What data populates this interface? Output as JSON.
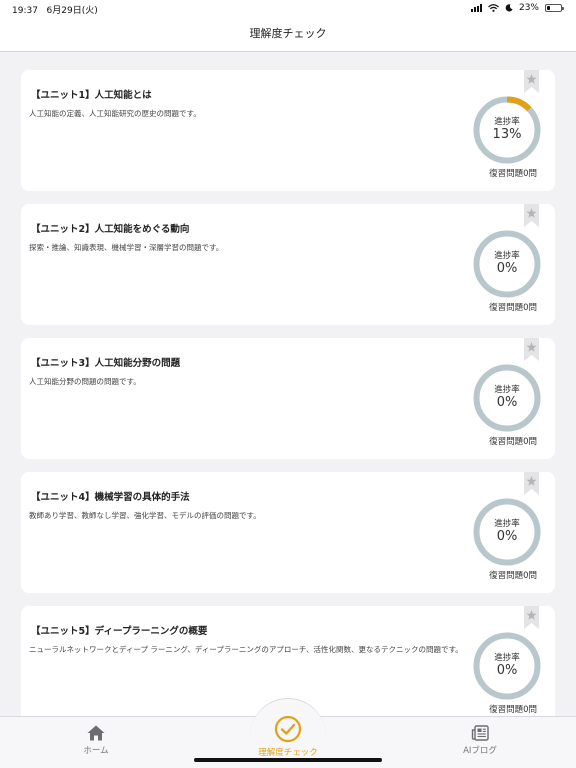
{
  "status_bar": {
    "time": "19:37",
    "date": "6月29日(火)",
    "battery": "23%",
    "battery_level": 0.23
  },
  "nav": {
    "title": "理解度チェック"
  },
  "colors": {
    "accent": "#e0a118",
    "ring_track": "#b7c7cc",
    "card_bg": "#ffffff",
    "page_bg": "#f2f2f5"
  },
  "units": [
    {
      "title": "【ユニット1】人工知能とは",
      "description": "人工知能の定義、人工知能研究の歴史の問題です。",
      "progress_label": "進捗率",
      "progress_text": "13%",
      "progress": 0.13,
      "review": "復習問題0問"
    },
    {
      "title": "【ユニット2】人工知能をめぐる動向",
      "description": "探索・推論、知識表現、機械学習・深層学習の問題です。",
      "progress_label": "進捗率",
      "progress_text": "0%",
      "progress": 0,
      "review": "復習問題0問"
    },
    {
      "title": "【ユニット3】人工知能分野の問題",
      "description": "人工知能分野の問題の問題です。",
      "progress_label": "進捗率",
      "progress_text": "0%",
      "progress": 0,
      "review": "復習問題0問"
    },
    {
      "title": "【ユニット4】機械学習の具体的手法",
      "description": "教師あり学習、教師なし学習、強化学習、モデルの評価の問題です。",
      "progress_label": "進捗率",
      "progress_text": "0%",
      "progress": 0,
      "review": "復習問題0問"
    },
    {
      "title": "【ユニット5】ディープラーニングの概要",
      "description": "ニューラルネットワークとディープ ラーニング、ディープラーニングのアプローチ、活性化関数、更なるテクニックの問題です。",
      "progress_label": "進捗率",
      "progress_text": "0%",
      "progress": 0,
      "review": "復習問題0問"
    }
  ],
  "tabs": {
    "home": {
      "label": "ホーム",
      "icon": "home-icon"
    },
    "check": {
      "label": "理解度チェック",
      "icon": "checkmark-circle-icon"
    },
    "blog": {
      "label": "AIブログ",
      "icon": "newspaper-icon"
    }
  }
}
